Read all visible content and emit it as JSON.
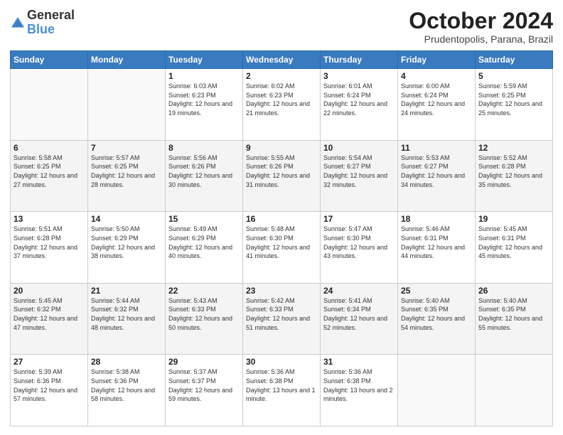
{
  "logo": {
    "general": "General",
    "blue": "Blue"
  },
  "header": {
    "month_year": "October 2024",
    "location": "Prudentopolis, Parana, Brazil"
  },
  "days_of_week": [
    "Sunday",
    "Monday",
    "Tuesday",
    "Wednesday",
    "Thursday",
    "Friday",
    "Saturday"
  ],
  "weeks": [
    [
      {
        "day": "",
        "sunrise": "",
        "sunset": "",
        "daylight": ""
      },
      {
        "day": "",
        "sunrise": "",
        "sunset": "",
        "daylight": ""
      },
      {
        "day": "1",
        "sunrise": "Sunrise: 6:03 AM",
        "sunset": "Sunset: 6:23 PM",
        "daylight": "Daylight: 12 hours and 19 minutes."
      },
      {
        "day": "2",
        "sunrise": "Sunrise: 6:02 AM",
        "sunset": "Sunset: 6:23 PM",
        "daylight": "Daylight: 12 hours and 21 minutes."
      },
      {
        "day": "3",
        "sunrise": "Sunrise: 6:01 AM",
        "sunset": "Sunset: 6:24 PM",
        "daylight": "Daylight: 12 hours and 22 minutes."
      },
      {
        "day": "4",
        "sunrise": "Sunrise: 6:00 AM",
        "sunset": "Sunset: 6:24 PM",
        "daylight": "Daylight: 12 hours and 24 minutes."
      },
      {
        "day": "5",
        "sunrise": "Sunrise: 5:59 AM",
        "sunset": "Sunset: 6:25 PM",
        "daylight": "Daylight: 12 hours and 25 minutes."
      }
    ],
    [
      {
        "day": "6",
        "sunrise": "Sunrise: 5:58 AM",
        "sunset": "Sunset: 6:25 PM",
        "daylight": "Daylight: 12 hours and 27 minutes."
      },
      {
        "day": "7",
        "sunrise": "Sunrise: 5:57 AM",
        "sunset": "Sunset: 6:25 PM",
        "daylight": "Daylight: 12 hours and 28 minutes."
      },
      {
        "day": "8",
        "sunrise": "Sunrise: 5:56 AM",
        "sunset": "Sunset: 6:26 PM",
        "daylight": "Daylight: 12 hours and 30 minutes."
      },
      {
        "day": "9",
        "sunrise": "Sunrise: 5:55 AM",
        "sunset": "Sunset: 6:26 PM",
        "daylight": "Daylight: 12 hours and 31 minutes."
      },
      {
        "day": "10",
        "sunrise": "Sunrise: 5:54 AM",
        "sunset": "Sunset: 6:27 PM",
        "daylight": "Daylight: 12 hours and 32 minutes."
      },
      {
        "day": "11",
        "sunrise": "Sunrise: 5:53 AM",
        "sunset": "Sunset: 6:27 PM",
        "daylight": "Daylight: 12 hours and 34 minutes."
      },
      {
        "day": "12",
        "sunrise": "Sunrise: 5:52 AM",
        "sunset": "Sunset: 6:28 PM",
        "daylight": "Daylight: 12 hours and 35 minutes."
      }
    ],
    [
      {
        "day": "13",
        "sunrise": "Sunrise: 5:51 AM",
        "sunset": "Sunset: 6:28 PM",
        "daylight": "Daylight: 12 hours and 37 minutes."
      },
      {
        "day": "14",
        "sunrise": "Sunrise: 5:50 AM",
        "sunset": "Sunset: 6:29 PM",
        "daylight": "Daylight: 12 hours and 38 minutes."
      },
      {
        "day": "15",
        "sunrise": "Sunrise: 5:49 AM",
        "sunset": "Sunset: 6:29 PM",
        "daylight": "Daylight: 12 hours and 40 minutes."
      },
      {
        "day": "16",
        "sunrise": "Sunrise: 5:48 AM",
        "sunset": "Sunset: 6:30 PM",
        "daylight": "Daylight: 12 hours and 41 minutes."
      },
      {
        "day": "17",
        "sunrise": "Sunrise: 5:47 AM",
        "sunset": "Sunset: 6:30 PM",
        "daylight": "Daylight: 12 hours and 43 minutes."
      },
      {
        "day": "18",
        "sunrise": "Sunrise: 5:46 AM",
        "sunset": "Sunset: 6:31 PM",
        "daylight": "Daylight: 12 hours and 44 minutes."
      },
      {
        "day": "19",
        "sunrise": "Sunrise: 5:45 AM",
        "sunset": "Sunset: 6:31 PM",
        "daylight": "Daylight: 12 hours and 45 minutes."
      }
    ],
    [
      {
        "day": "20",
        "sunrise": "Sunrise: 5:45 AM",
        "sunset": "Sunset: 6:32 PM",
        "daylight": "Daylight: 12 hours and 47 minutes."
      },
      {
        "day": "21",
        "sunrise": "Sunrise: 5:44 AM",
        "sunset": "Sunset: 6:32 PM",
        "daylight": "Daylight: 12 hours and 48 minutes."
      },
      {
        "day": "22",
        "sunrise": "Sunrise: 5:43 AM",
        "sunset": "Sunset: 6:33 PM",
        "daylight": "Daylight: 12 hours and 50 minutes."
      },
      {
        "day": "23",
        "sunrise": "Sunrise: 5:42 AM",
        "sunset": "Sunset: 6:33 PM",
        "daylight": "Daylight: 12 hours and 51 minutes."
      },
      {
        "day": "24",
        "sunrise": "Sunrise: 5:41 AM",
        "sunset": "Sunset: 6:34 PM",
        "daylight": "Daylight: 12 hours and 52 minutes."
      },
      {
        "day": "25",
        "sunrise": "Sunrise: 5:40 AM",
        "sunset": "Sunset: 6:35 PM",
        "daylight": "Daylight: 12 hours and 54 minutes."
      },
      {
        "day": "26",
        "sunrise": "Sunrise: 5:40 AM",
        "sunset": "Sunset: 6:35 PM",
        "daylight": "Daylight: 12 hours and 55 minutes."
      }
    ],
    [
      {
        "day": "27",
        "sunrise": "Sunrise: 5:39 AM",
        "sunset": "Sunset: 6:36 PM",
        "daylight": "Daylight: 12 hours and 57 minutes."
      },
      {
        "day": "28",
        "sunrise": "Sunrise: 5:38 AM",
        "sunset": "Sunset: 6:36 PM",
        "daylight": "Daylight: 12 hours and 58 minutes."
      },
      {
        "day": "29",
        "sunrise": "Sunrise: 5:37 AM",
        "sunset": "Sunset: 6:37 PM",
        "daylight": "Daylight: 12 hours and 59 minutes."
      },
      {
        "day": "30",
        "sunrise": "Sunrise: 5:36 AM",
        "sunset": "Sunset: 6:38 PM",
        "daylight": "Daylight: 13 hours and 1 minute."
      },
      {
        "day": "31",
        "sunrise": "Sunrise: 5:36 AM",
        "sunset": "Sunset: 6:38 PM",
        "daylight": "Daylight: 13 hours and 2 minutes."
      },
      {
        "day": "",
        "sunrise": "",
        "sunset": "",
        "daylight": ""
      },
      {
        "day": "",
        "sunrise": "",
        "sunset": "",
        "daylight": ""
      }
    ]
  ]
}
